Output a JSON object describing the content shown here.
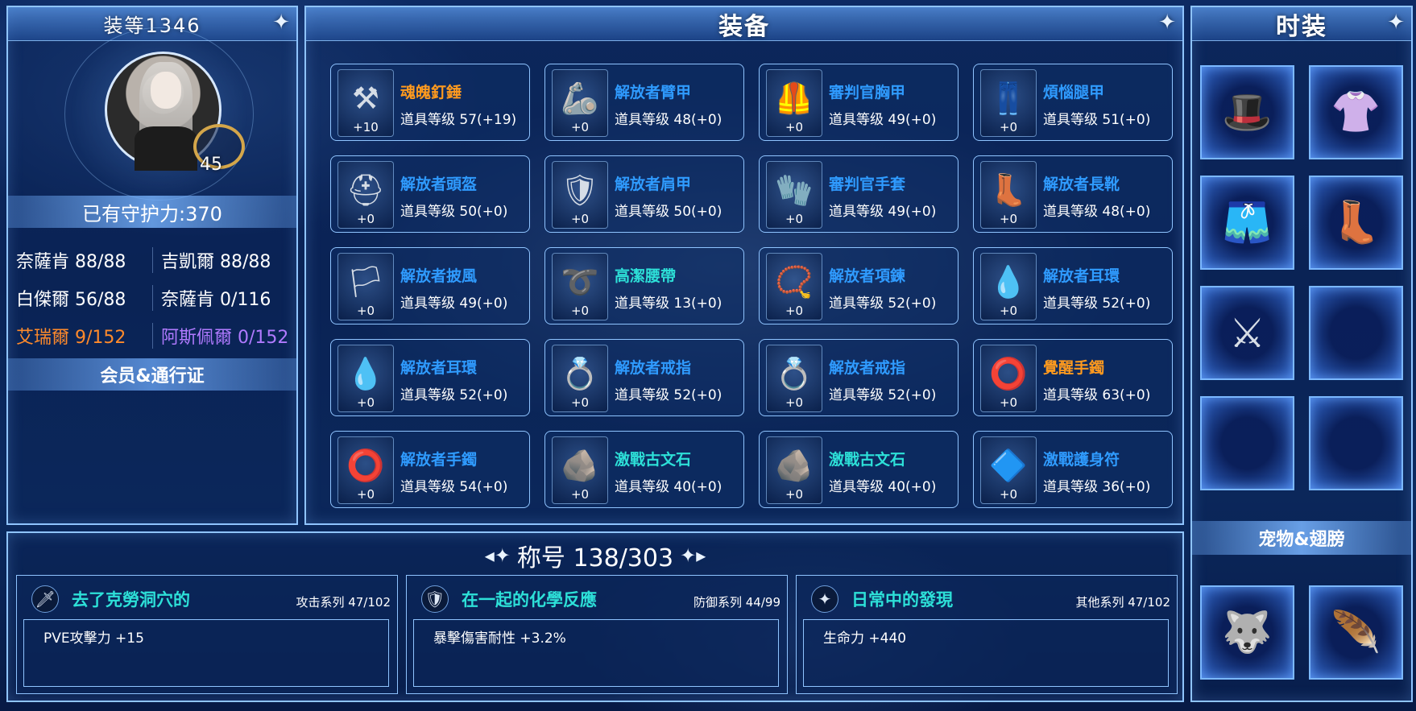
{
  "left_panel": {
    "title": "装等1346",
    "level": "45",
    "guard_power": "已有守护力:370",
    "stats": [
      [
        "奈薩肯 88/88",
        "吉凱爾 88/88"
      ],
      [
        "白傑爾 56/88",
        "奈薩肯 0/116"
      ],
      [
        "艾瑞爾 9/152",
        "阿斯佩爾 0/152"
      ]
    ],
    "member_label": "会员&通行证"
  },
  "center_panel": {
    "title": "装备",
    "items": [
      {
        "name": "魂魄釘錘",
        "level": "道具等级 57(+19)",
        "plus": "+10",
        "icon": "mace-icon",
        "color": "orange"
      },
      {
        "name": "解放者臂甲",
        "level": "道具等级 48(+0)",
        "plus": "+0",
        "icon": "arm-guard-icon",
        "color": "blue"
      },
      {
        "name": "審判官胸甲",
        "level": "道具等级 49(+0)",
        "plus": "+0",
        "icon": "chestplate-icon",
        "color": "blue"
      },
      {
        "name": "煩惱腿甲",
        "level": "道具等级 51(+0)",
        "plus": "+0",
        "icon": "leg-armor-icon",
        "color": "blue"
      },
      {
        "name": "解放者頭盔",
        "level": "道具等级 50(+0)",
        "plus": "+0",
        "icon": "helmet-icon",
        "color": "blue"
      },
      {
        "name": "解放者肩甲",
        "level": "道具等级 50(+0)",
        "plus": "+0",
        "icon": "shoulder-armor-icon",
        "color": "blue"
      },
      {
        "name": "審判官手套",
        "level": "道具等级 49(+0)",
        "plus": "+0",
        "icon": "gloves-icon",
        "color": "blue"
      },
      {
        "name": "解放者長靴",
        "level": "道具等级 48(+0)",
        "plus": "+0",
        "icon": "boots-icon",
        "color": "blue"
      },
      {
        "name": "解放者披風",
        "level": "道具等级 49(+0)",
        "plus": "+0",
        "icon": "cape-icon",
        "color": "blue"
      },
      {
        "name": "高潔腰帶",
        "level": "道具等级 13(+0)",
        "plus": "+0",
        "icon": "belt-icon",
        "color": "cyan"
      },
      {
        "name": "解放者項鍊",
        "level": "道具等级 52(+0)",
        "plus": "+0",
        "icon": "necklace-icon",
        "color": "blue"
      },
      {
        "name": "解放者耳環",
        "level": "道具等级 52(+0)",
        "plus": "+0",
        "icon": "earring-icon",
        "color": "blue"
      },
      {
        "name": "解放者耳環",
        "level": "道具等级 52(+0)",
        "plus": "+0",
        "icon": "earring-icon",
        "color": "blue"
      },
      {
        "name": "解放者戒指",
        "level": "道具等级 52(+0)",
        "plus": "+0",
        "icon": "ring-icon",
        "color": "blue"
      },
      {
        "name": "解放者戒指",
        "level": "道具等级 52(+0)",
        "plus": "+0",
        "icon": "ring-icon",
        "color": "blue"
      },
      {
        "name": "覺醒手鐲",
        "level": "道具等级 63(+0)",
        "plus": "+0",
        "icon": "bracelet-icon",
        "color": "orange"
      },
      {
        "name": "解放者手鐲",
        "level": "道具等级 54(+0)",
        "plus": "+0",
        "icon": "bracelet-icon",
        "color": "blue"
      },
      {
        "name": "激戰古文石",
        "level": "道具等级 40(+0)",
        "plus": "+0",
        "icon": "rune-stone-icon",
        "color": "cyan"
      },
      {
        "name": "激戰古文石",
        "level": "道具等级 40(+0)",
        "plus": "+0",
        "icon": "rune-stone-icon",
        "color": "cyan"
      },
      {
        "name": "激戰護身符",
        "level": "道具等级 36(+0)",
        "plus": "+0",
        "icon": "amulet-icon",
        "color": "blue"
      }
    ]
  },
  "right_panel": {
    "title": "时装",
    "slots": [
      {
        "icon": "hat-icon",
        "glyph": "🎩"
      },
      {
        "icon": "top-icon",
        "glyph": "👚"
      },
      {
        "icon": "shorts-icon",
        "glyph": "🩳"
      },
      {
        "icon": "boots-icon",
        "glyph": "👢"
      },
      {
        "icon": "weapon-skin-icon",
        "glyph": "⚔"
      },
      {
        "icon": "empty-slot",
        "glyph": ""
      },
      {
        "icon": "empty-slot",
        "glyph": ""
      },
      {
        "icon": "empty-slot",
        "glyph": ""
      }
    ],
    "pet_label": "宠物&翅膀",
    "pets": [
      {
        "icon": "pet-icon",
        "glyph": "🐺"
      },
      {
        "icon": "wings-icon",
        "glyph": "🪶"
      }
    ]
  },
  "titles_panel": {
    "heading": "称号 138/303",
    "cards": [
      {
        "name": "去了克勞洞穴的",
        "series": "攻击系列 47/102",
        "effect": "PVE攻擊力 +15",
        "icon": "sword-icon",
        "glyph": "🗡"
      },
      {
        "name": "在一起的化學反應",
        "series": "防御系列 44/99",
        "effect": "暴擊傷害耐性 +3.2%",
        "icon": "shield-icon",
        "glyph": "🛡"
      },
      {
        "name": "日常中的發現",
        "series": "其他系列 47/102",
        "effect": "生命力 +440",
        "icon": "star-icon",
        "glyph": "✦"
      }
    ]
  },
  "colors": {
    "orange": "#ff9a1e",
    "blue": "#2f9bff",
    "cyan": "#2de0d8",
    "border": "#8fc4ff"
  }
}
